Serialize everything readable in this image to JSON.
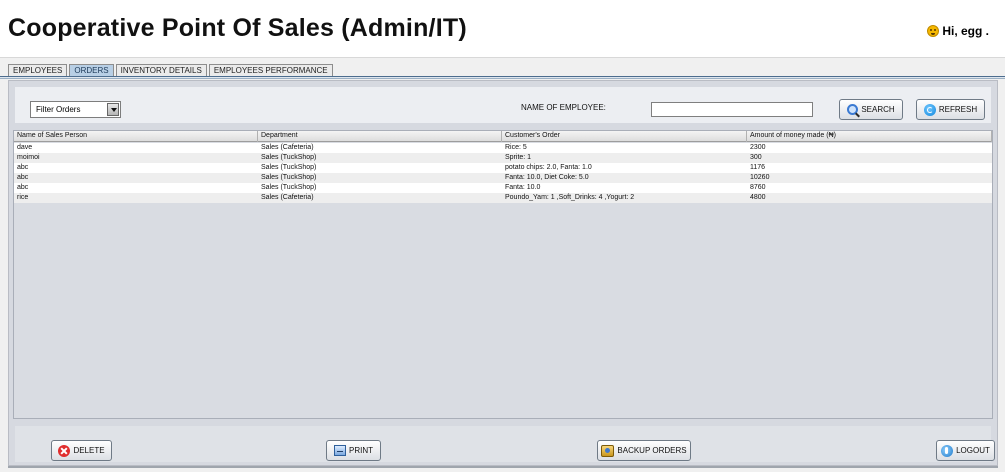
{
  "app": {
    "title": "Cooperative Point Of Sales (Admin/IT)",
    "greeting": "Hi,  egg  ."
  },
  "tabs": [
    {
      "label": "EMPLOYEES",
      "active": false
    },
    {
      "label": "ORDERS",
      "active": true
    },
    {
      "label": "INVENTORY DETAILS",
      "active": false
    },
    {
      "label": "EMPLOYEES PERFORMANCE",
      "active": false
    }
  ],
  "toolbar": {
    "filter_value": "Filter Orders",
    "employee_label": "NAME OF EMPLOYEE:",
    "employee_value": "",
    "search_label": "SEARCH",
    "refresh_label": "REFRESH"
  },
  "table": {
    "headers": [
      "Name of Sales Person",
      "Department",
      "Customer's Order",
      "Amount of money made (₦)"
    ],
    "rows": [
      {
        "name": "dave",
        "department": "Sales (Cafeteria)",
        "order": "Rice: 5",
        "amount": "2300"
      },
      {
        "name": "moimoi",
        "department": "Sales (TuckShop)",
        "order": "Sprite: 1",
        "amount": "300"
      },
      {
        "name": "abc",
        "department": "Sales (TuckShop)",
        "order": "potato chips: 2.0, Fanta: 1.0",
        "amount": "1176"
      },
      {
        "name": "abc",
        "department": "Sales (TuckShop)",
        "order": "Fanta: 10.0, Diet Coke: 5.0",
        "amount": "10260"
      },
      {
        "name": "abc",
        "department": "Sales (TuckShop)",
        "order": "Fanta: 10.0",
        "amount": "8760"
      },
      {
        "name": " rice",
        "department": "Sales (Cafeteria)",
        "order": "Poundo_Yam: 1 ,Soft_Drinks: 4 ,Yogurt: 2",
        "amount": "4800"
      }
    ]
  },
  "actions": {
    "delete_label": "DELETE",
    "print_label": "PRINT",
    "backup_label": "BACKUP ORDERS",
    "logout_label": "LOGOUT"
  },
  "colors": {
    "header_bg": "#ffffff",
    "panel_bg": "#d6d9e0",
    "active_tab": "#b8cfe5",
    "delete_icon": "#e02d2d",
    "refresh_icon": "#0f86dd"
  },
  "icons": [
    "smiley-icon",
    "select-arrow-icon",
    "search-icon",
    "refresh-icon",
    "delete-icon",
    "print-icon",
    "backup-icon",
    "logout-icon"
  ]
}
